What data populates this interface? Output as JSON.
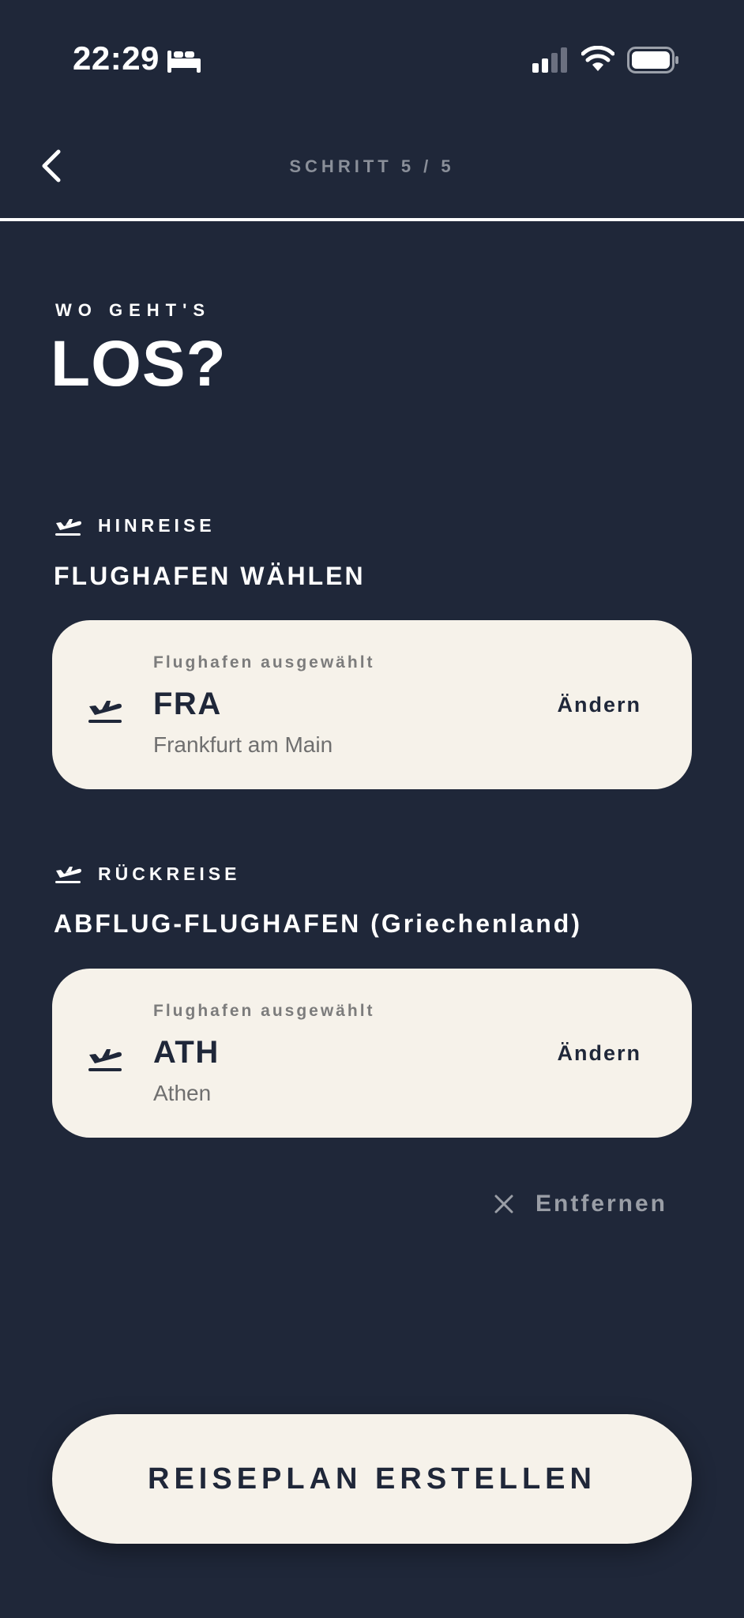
{
  "status_bar": {
    "time": "22:29"
  },
  "header": {
    "step": "SCHRITT 5 / 5"
  },
  "headline": {
    "eyebrow": "WO GEHT'S",
    "title": "LOS?"
  },
  "outbound": {
    "label": "HINREISE",
    "title": "FLUGHAFEN WÄHLEN",
    "card": {
      "caption": "Flughafen ausgewählt",
      "code": "FRA",
      "city": "Frankfurt am Main",
      "change_label": "Ändern"
    }
  },
  "return": {
    "label": "RÜCKREISE",
    "title": "ABFLUG-FLUGHAFEN (Griechenland)",
    "card": {
      "caption": "Flughafen ausgewählt",
      "code": "ATH",
      "city": "Athen",
      "change_label": "Ändern"
    },
    "remove_label": "Entfernen"
  },
  "cta": {
    "label": "REISEPLAN ERSTELLEN"
  },
  "colors": {
    "background": "#1f2739",
    "card": "#f6f2ea",
    "muted": "#8a8f99"
  },
  "icons": [
    "bed-icon",
    "cellular-signal-icon",
    "wifi-icon",
    "battery-icon",
    "back-chevron-icon",
    "plane-departure-icon",
    "close-icon"
  ]
}
